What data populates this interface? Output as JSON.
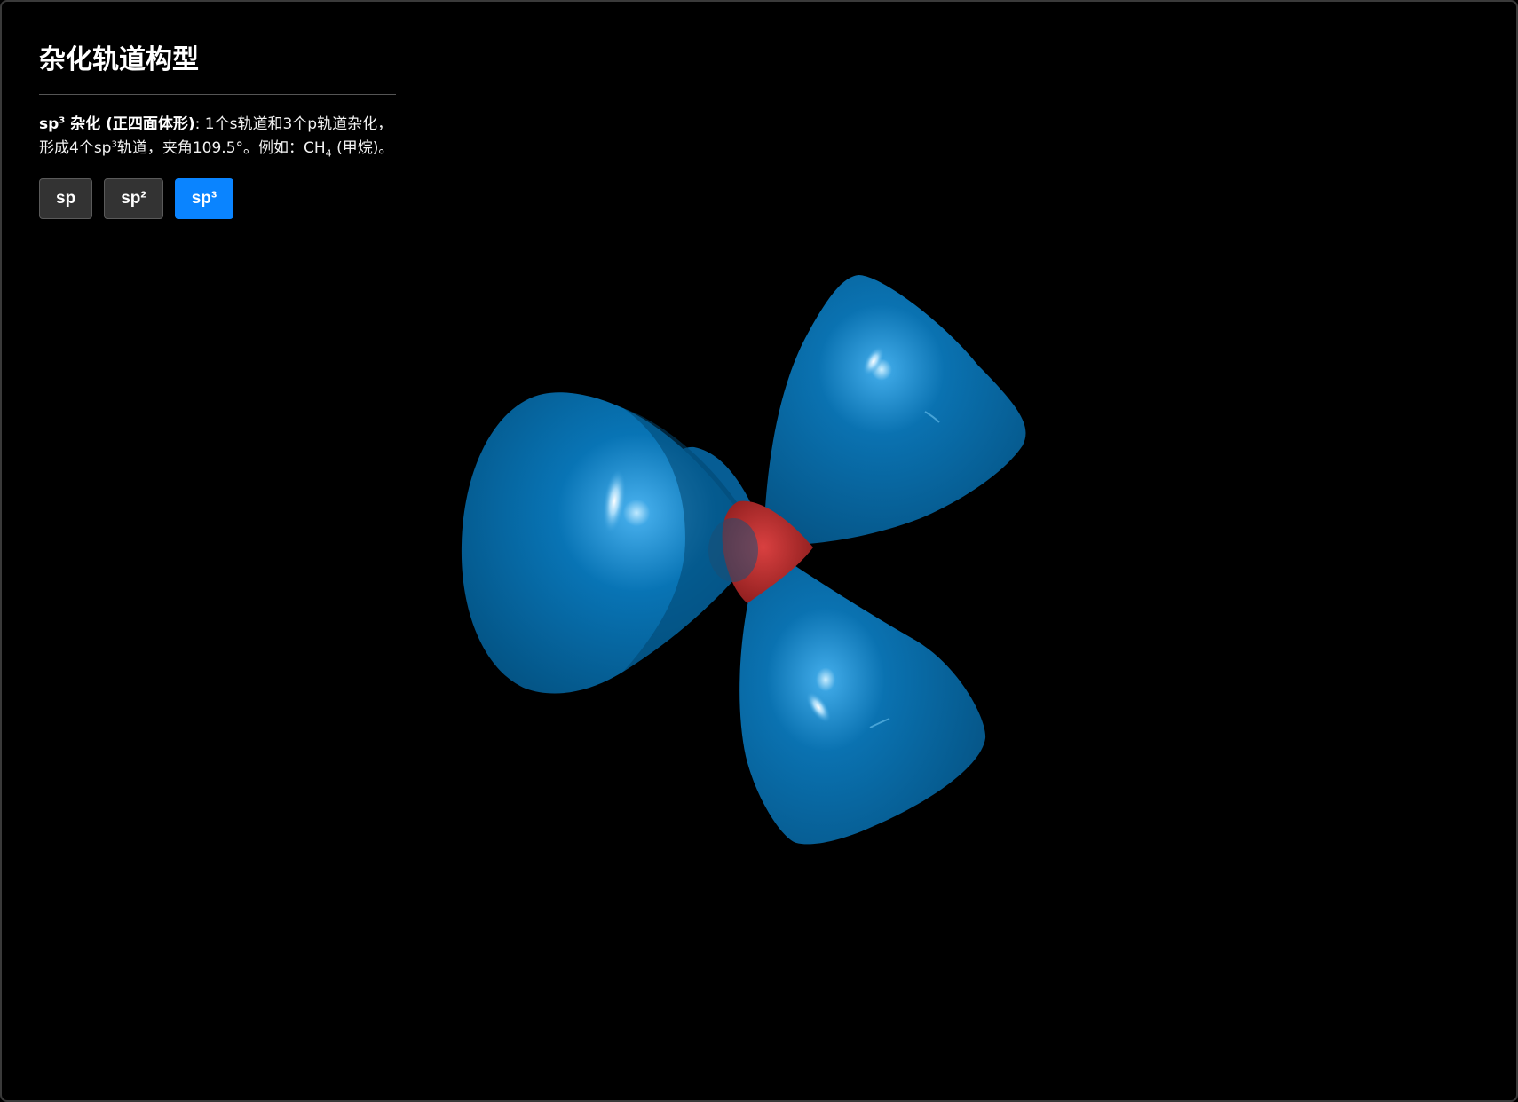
{
  "panel": {
    "title": "杂化轨道构型",
    "description": {
      "term_prefix": "sp",
      "term_sup": "3",
      "term_suffix": " 杂化 (正四面体形)",
      "text_1": ": 1个s轨道和3个p轨道杂化，形成4个sp",
      "text_sup": "3",
      "text_2": "轨道，夹角109.5°。例如：CH",
      "text_sub": "4",
      "text_3": " (甲烷)。"
    },
    "buttons": [
      {
        "label": "sp",
        "active": false
      },
      {
        "label": "sp²",
        "active": false
      },
      {
        "label": "sp³",
        "active": true
      }
    ]
  },
  "scene": {
    "orbital_color": "#0a6fab",
    "nucleus_color": "#c0302e",
    "background": "#000000"
  }
}
